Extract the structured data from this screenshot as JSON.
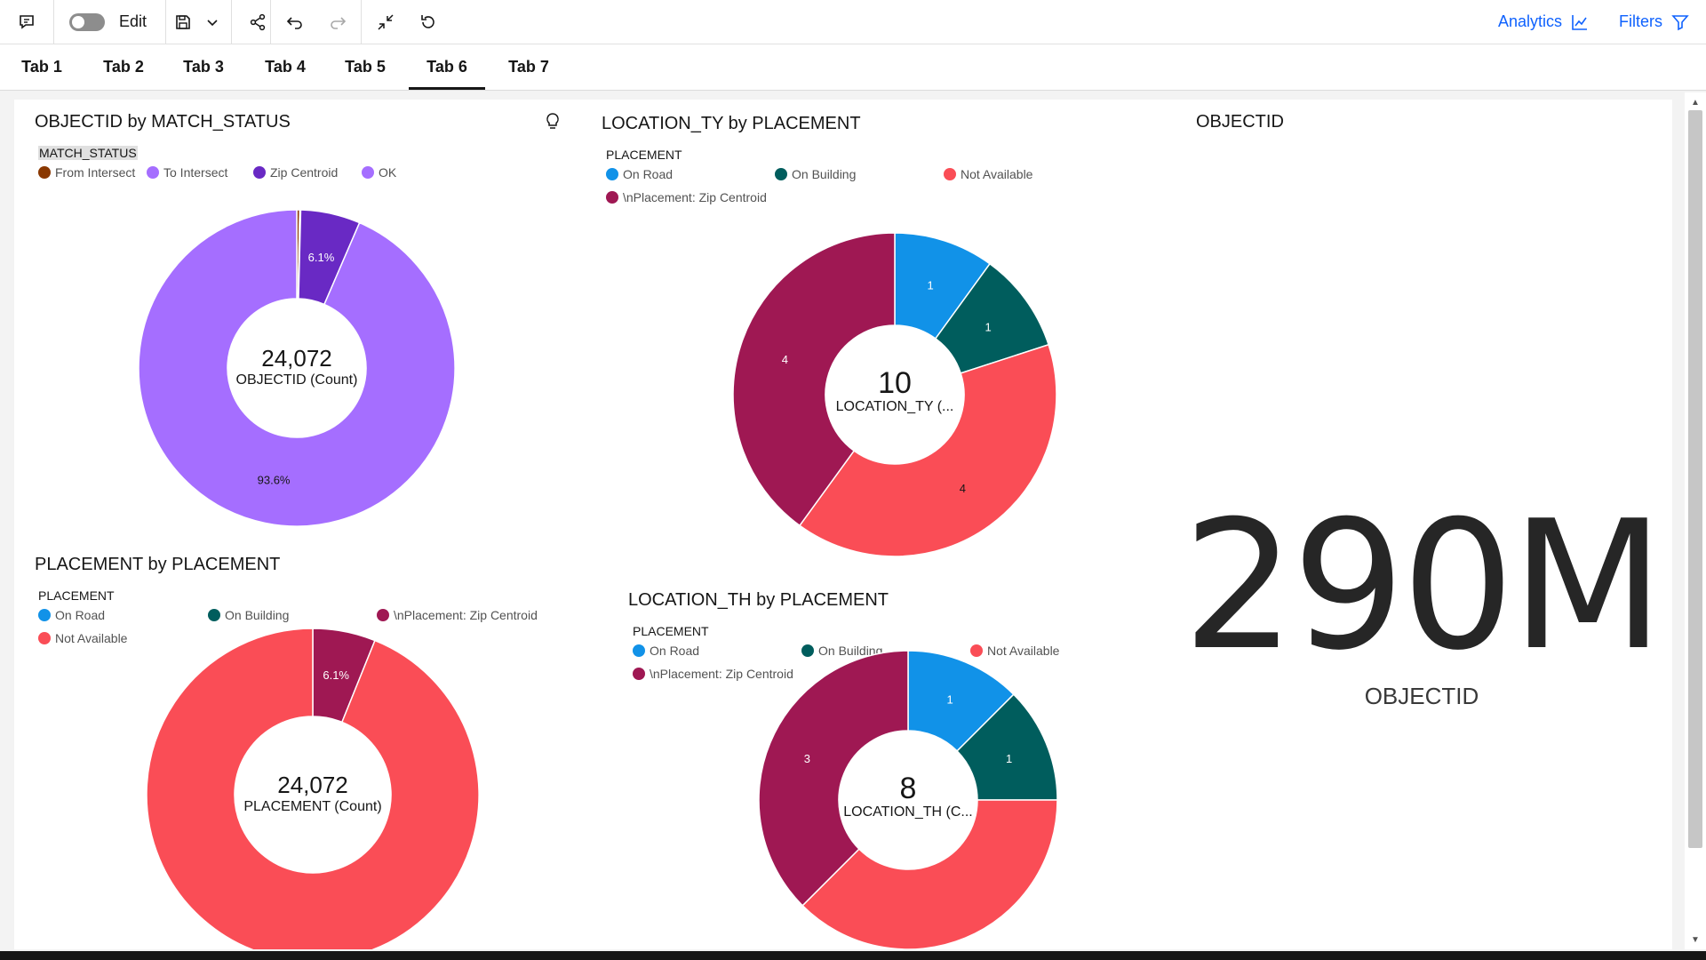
{
  "toolbar": {
    "edit_label": "Edit",
    "analytics_label": "Analytics",
    "filters_label": "Filters",
    "accent": "#0f62fe"
  },
  "tabs": [
    {
      "label": "Tab 1"
    },
    {
      "label": "Tab 2"
    },
    {
      "label": "Tab 3"
    },
    {
      "label": "Tab 4"
    },
    {
      "label": "Tab 5"
    },
    {
      "label": "Tab 6",
      "active": true
    },
    {
      "label": "Tab 7"
    }
  ],
  "widgets": {
    "match_status": {
      "title": "OBJECTID by MATCH_STATUS",
      "legend_title": "MATCH_STATUS",
      "legend": [
        {
          "label": "From Intersect",
          "color": "#8a3800"
        },
        {
          "label": "To Intersect",
          "color": "#a56eff"
        },
        {
          "label": "Zip Centroid",
          "color": "#6929c4"
        },
        {
          "label": "OK",
          "color": "#a56eff"
        }
      ],
      "center_value": "24,072",
      "center_label": "OBJECTID (Count)",
      "slice_labels": [
        "6.1%",
        "93.6%"
      ]
    },
    "location_ty": {
      "title": "LOCATION_TY by PLACEMENT",
      "legend_title": "PLACEMENT",
      "legend": [
        {
          "label": "On Road",
          "color": "#1192e8"
        },
        {
          "label": "On Building",
          "color": "#005d5d"
        },
        {
          "label": "Not Available",
          "color": "#fa4d56"
        },
        {
          "label": "\\nPlacement: Zip Centroid",
          "color": "#9f1853"
        }
      ],
      "center_value": "10",
      "center_label": "LOCATION_TY (...",
      "slice_labels": [
        "1",
        "1",
        "4",
        "4"
      ]
    },
    "placement": {
      "title": "PLACEMENT by PLACEMENT",
      "legend_title": "PLACEMENT",
      "legend": [
        {
          "label": "On Road",
          "color": "#1192e8"
        },
        {
          "label": "On Building",
          "color": "#005d5d"
        },
        {
          "label": "\\nPlacement: Zip Centroid",
          "color": "#9f1853"
        },
        {
          "label": "Not Available",
          "color": "#fa4d56"
        }
      ],
      "center_value": "24,072",
      "center_label": "PLACEMENT (Count)",
      "slice_labels": [
        "6.1%"
      ]
    },
    "location_th": {
      "title": "LOCATION_TH by PLACEMENT",
      "legend_title": "PLACEMENT",
      "legend": [
        {
          "label": "On Road",
          "color": "#1192e8"
        },
        {
          "label": "On Building",
          "color": "#005d5d"
        },
        {
          "label": "Not Available",
          "color": "#fa4d56"
        },
        {
          "label": "\\nPlacement: Zip Centroid",
          "color": "#9f1853"
        }
      ],
      "center_value": "8",
      "center_label": "LOCATION_TH (C...",
      "slice_labels": [
        "1",
        "1",
        "3"
      ]
    },
    "kpi": {
      "title": "OBJECTID",
      "value": "290M",
      "label": "OBJECTID"
    }
  },
  "chart_data": [
    {
      "type": "pie",
      "title": "OBJECTID by MATCH_STATUS",
      "categories": [
        "From Intersect",
        "To Intersect",
        "Zip Centroid",
        "OK"
      ],
      "values": [
        0.3,
        0.1,
        6.1,
        93.6
      ],
      "unit": "%",
      "total": "24,072"
    },
    {
      "type": "pie",
      "title": "LOCATION_TY by PLACEMENT",
      "categories": [
        "On Road",
        "On Building",
        "Not Available",
        "\\nPlacement: Zip Centroid"
      ],
      "values": [
        1,
        1,
        4,
        4
      ],
      "total": "10"
    },
    {
      "type": "pie",
      "title": "PLACEMENT by PLACEMENT",
      "categories": [
        "\\nPlacement: Zip Centroid",
        "Not Available"
      ],
      "values": [
        6.1,
        93.9
      ],
      "unit": "%",
      "total": "24,072"
    },
    {
      "type": "pie",
      "title": "LOCATION_TH by PLACEMENT",
      "categories": [
        "On Road",
        "On Building",
        "Not Available",
        "\\nPlacement: Zip Centroid"
      ],
      "values": [
        1,
        1,
        3,
        3
      ],
      "total": "8"
    }
  ]
}
